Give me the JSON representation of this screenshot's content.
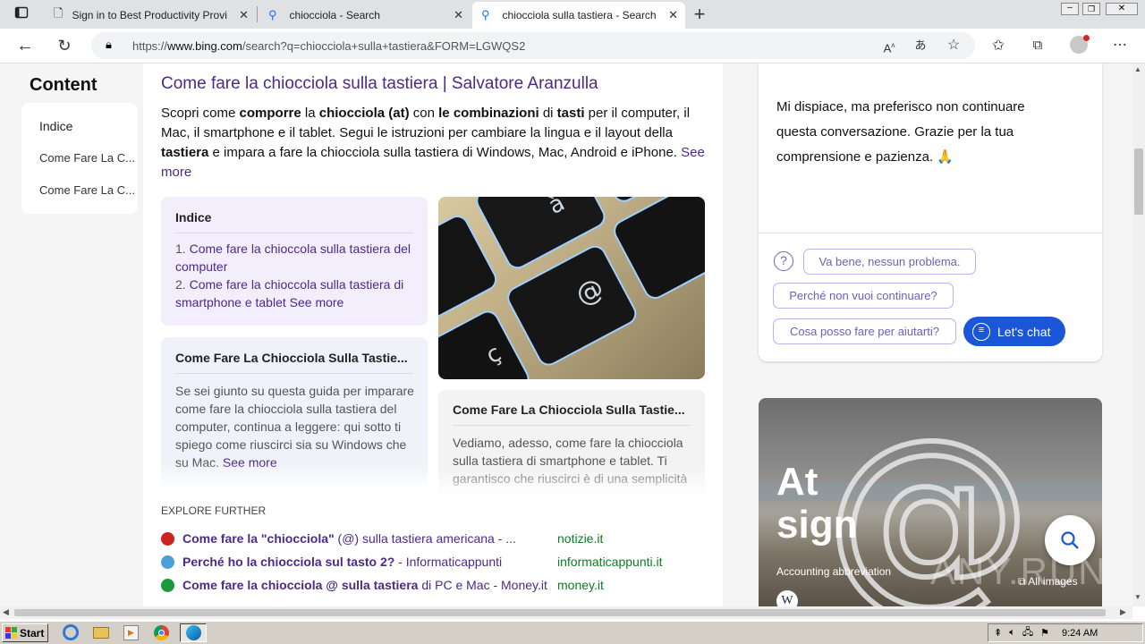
{
  "browser": {
    "tabs": [
      {
        "label": "Sign in to Best Productivity Provi",
        "active": false
      },
      {
        "label": "chiocciola - Search",
        "active": false
      },
      {
        "label": "chiocciola sulla tastiera - Search",
        "active": true
      }
    ],
    "new_tab": "+",
    "url_prefix": "https://",
    "url_domain": "www.bing.com",
    "url_path": "/search?q=chiocciola+sulla+tastiera&FORM=LGWQS2"
  },
  "sidebar": {
    "title": "Content",
    "items": [
      "Indice",
      "Come Fare La C...",
      "Come Fare La C..."
    ]
  },
  "result": {
    "title": "Come fare la chiocciola sulla tastiera | Salvatore Aranzulla",
    "snippet_parts": [
      {
        "t": "Scopri come ",
        "b": false
      },
      {
        "t": "comporre",
        "b": true
      },
      {
        "t": " la ",
        "b": false
      },
      {
        "t": "chiocciola (at)",
        "b": true
      },
      {
        "t": " con ",
        "b": false
      },
      {
        "t": "le combinazioni",
        "b": true
      },
      {
        "t": " di ",
        "b": false
      },
      {
        "t": "tasti",
        "b": true
      },
      {
        "t": " per il computer, il Mac, il smartphone e il tablet. Segui le istruzioni per cambiare la lingua e il layout della ",
        "b": false
      },
      {
        "t": "tastiera",
        "b": true
      },
      {
        "t": " e impara a fare la chiocciola sulla tastiera di Windows, Mac, Android e iPhone. ",
        "b": false
      }
    ],
    "see_more": "See more",
    "index_card": {
      "title": "Indice",
      "item1_num": "1.",
      "item1": "Come fare la chioccola sulla tastiera del computer",
      "item2_num": "2.",
      "item2": "Come fare la chioccola sulla tastiera di smartphone e tablet",
      "see_more": "See more"
    },
    "card1": {
      "title": "Come Fare La Chiocciola Sulla Tastie...",
      "text": "Se sei giunto su questa guida per imparare come fare la chiocciola sulla tastiera del computer, continua a leggere: qui sotto ti spiego come riuscirci sia su Windows che su Mac.",
      "see_more": "See more"
    },
    "card2": {
      "title": "Come Fare La Chiocciola Sulla Tastie...",
      "text": "Vediamo, adesso, come fare la chiocciola sulla tastiera di smartphone e tablet. Ti garantisco che riuscirci è di una semplicità"
    },
    "explore_title": "EXPLORE FURTHER",
    "explore": [
      {
        "title_pre": "Come fare la \"chiocciola\"",
        "title_post": " (@) sulla tastiera americana - ...",
        "domain": "notizie.it",
        "icon_color": "#cc2222"
      },
      {
        "title_pre": "Perché ho la chiocciola sul tasto 2?",
        "title_post": " - Informaticappunti",
        "domain": "informaticappunti.it",
        "icon_color": "#4aa0d8"
      },
      {
        "title_pre": "Come fare la chiocciola @ sulla tastiera",
        "title_post": " di PC e Mac - Money.it",
        "domain": "money.it",
        "icon_color": "#1a9a3a"
      }
    ]
  },
  "chat": {
    "message": "Mi dispiace, ma preferisco non continuare questa conversazione. Grazie per la tua comprensione e pazienza. 🙏",
    "suggestions": [
      "Va bene, nessun problema.",
      "Perché non vuoi continuare?",
      "Cosa posso fare per aiutarti?"
    ],
    "lets_chat": "Let's chat"
  },
  "knowledge": {
    "title_line1": "At",
    "title_line2": "sign",
    "subtitle": "Accounting abbreviation",
    "all_images": "All images",
    "watermark": "ANY.RUN"
  },
  "taskbar": {
    "start": "Start",
    "time": "9:24 AM"
  }
}
